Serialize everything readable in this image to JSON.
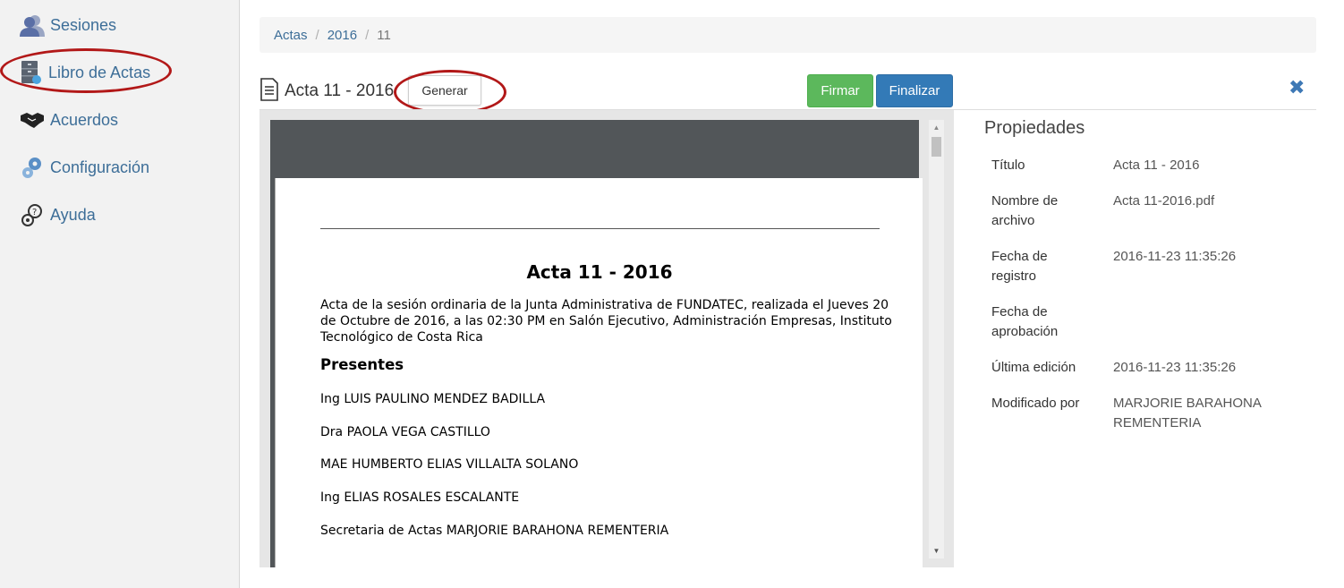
{
  "sidebar": {
    "items": [
      {
        "label": "Sesiones",
        "icon": "users-icon"
      },
      {
        "label": "Libro de Actas",
        "icon": "archive-icon"
      },
      {
        "label": "Acuerdos",
        "icon": "handshake-icon"
      },
      {
        "label": "Configuración",
        "icon": "gears-icon"
      },
      {
        "label": "Ayuda",
        "icon": "help-gear-icon"
      }
    ]
  },
  "breadcrumb": {
    "items": [
      "Actas",
      "2016",
      "11"
    ],
    "separator": "/"
  },
  "document": {
    "title": "Acta 11 - 2016",
    "generate_label": "Generar",
    "sign_label": "Firmar",
    "finalize_label": "Finalizar",
    "close_glyph": "✖"
  },
  "pdf": {
    "title": "Acta 11 - 2016",
    "intro": "Acta de la sesión ordinaria de la Junta Administrativa de FUNDATEC, realizada el Jueves 20 de Octubre de 2016, a las 02:30 PM en Salón Ejecutivo, Administración Empresas, Instituto Tecnológico de Costa Rica",
    "present_heading": "Presentes",
    "present": [
      "Ing LUIS PAULINO MENDEZ BADILLA",
      "Dra PAOLA VEGA CASTILLO",
      "MAE HUMBERTO ELIAS VILLALTA SOLANO",
      "Ing ELIAS ROSALES ESCALANTE",
      "Secretaria de Actas MARJORIE BARAHONA REMENTERIA"
    ]
  },
  "properties": {
    "heading": "Propiedades",
    "rows": [
      {
        "label": "Título",
        "value": "Acta 11 - 2016"
      },
      {
        "label": "Nombre de archivo",
        "value": "Acta 11-2016.pdf"
      },
      {
        "label": "Fecha de registro",
        "value": "2016-11-23 11:35:26"
      },
      {
        "label": "Fecha de aprobación",
        "value": ""
      },
      {
        "label": "Última edición",
        "value": "2016-11-23 11:35:26"
      },
      {
        "label": "Modificado por",
        "value": "MARJORIE BARAHONA REMENTERIA"
      }
    ]
  },
  "colors": {
    "link": "#3d6e98",
    "success": "#5cb85c",
    "primary": "#337ab7",
    "annotation": "#b21818"
  }
}
